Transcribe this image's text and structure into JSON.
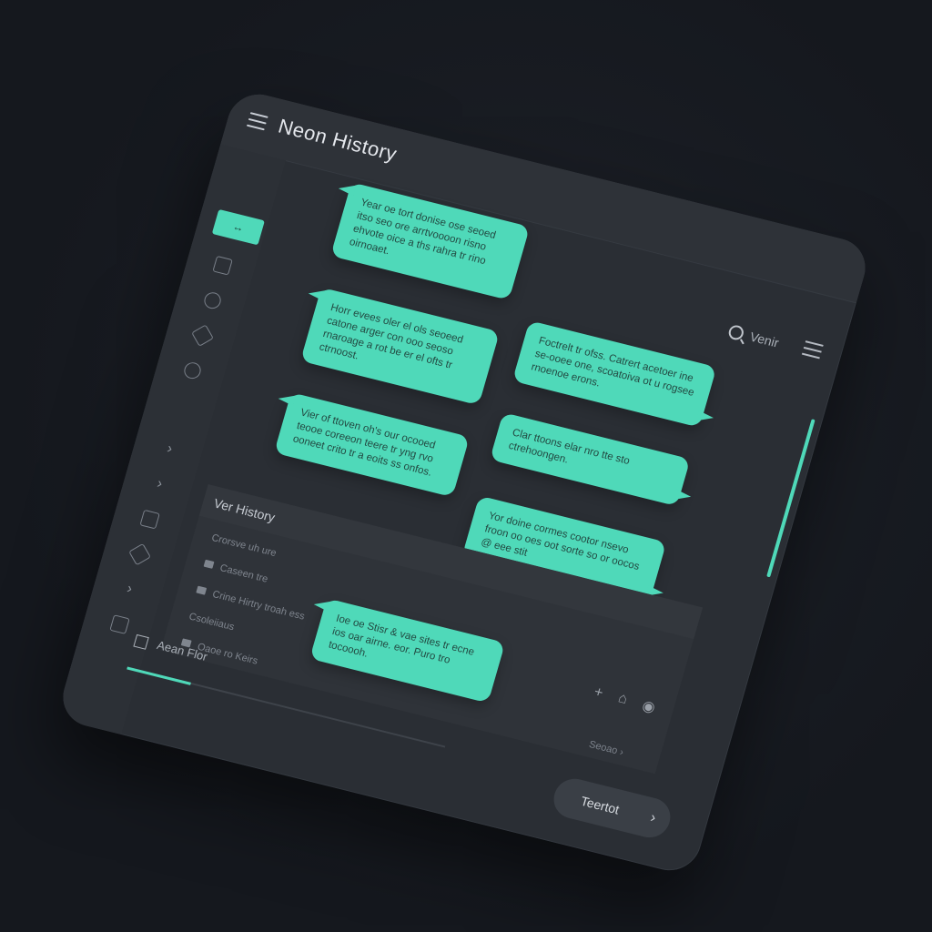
{
  "app": {
    "title": "Neon History"
  },
  "toolbar": {
    "search_label": "Venir"
  },
  "sidebar": {
    "active_label": "↔"
  },
  "bubbles": [
    {
      "text": "Year oe tort donise ose seoed itso seo ore arrtvoooon risno ehvote oice a ths rahra tr rino oirnoaet."
    },
    {
      "text": "Horr evees oler el ols seoeed catone arger con ooo seoso rnaroage a rot be er el ofts tr ctrnoost."
    },
    {
      "text": "Vier of ttoven oh's our ocooed teooe coreeon teere tr yng rvo ooneet crito tr a eoits ss onfos."
    },
    {
      "text": "Foctrelt tr ofss. Catrert acetoer ine se-ooee one, scoatoiva ot u rogsee rnoenoe erons."
    },
    {
      "text": "Clar ttoons elar nro tte sto ctrehoongen."
    },
    {
      "text": "Yor doine cormes cootor nsevo froon oo oes oot sorte so or oocos @ eee stit"
    },
    {
      "text": "Ioe oe Stisr & vae sites tr ecne ios oar airne. eor. Puro tro tocoooh."
    }
  ],
  "history": {
    "header": "Ver History",
    "rows": [
      "Crorsve uh ure",
      "Caseen tre",
      "Crine Hirtry troah ess",
      "Csoleiiaus",
      "Oaoe ro Keirs"
    ],
    "send_label": "Seoao"
  },
  "bottom": {
    "field_label": "Aean Flor",
    "progress_value": 0.2
  },
  "cta": {
    "label": "Teertot"
  },
  "colors": {
    "accent": "#4fd9b9",
    "background": "#16191f",
    "panel": "#2a2e34"
  }
}
